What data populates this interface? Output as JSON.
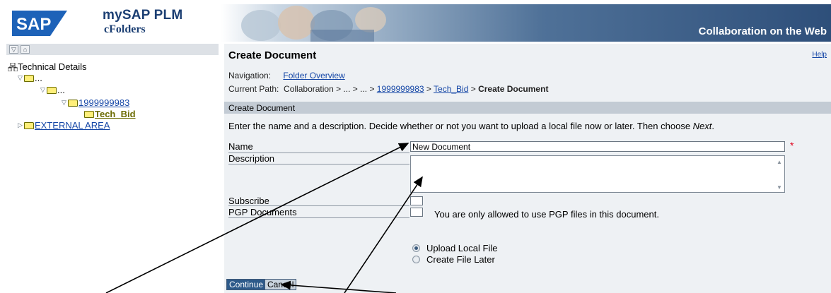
{
  "header": {
    "brand_line1": "mySAP PLM",
    "brand_line2": "cFolders",
    "logo_text": "SAP",
    "tagline": "Collaboration on the Web"
  },
  "tree": {
    "root_label": "Technical Details",
    "items": [
      {
        "label": "..."
      },
      {
        "label": "..."
      },
      {
        "label": "1999999983"
      },
      {
        "label": "Tech_Bid"
      },
      {
        "label": "EXTERNAL AREA"
      }
    ]
  },
  "page": {
    "title": "Create Document",
    "help": "Help",
    "navigation_label": "Navigation:",
    "navigation_link": "Folder Overview",
    "path_label": "Current Path:",
    "path_parts": {
      "p1": "Collaboration > ... > ... > ",
      "p2": "1999999983",
      "p3": " > ",
      "p4": "Tech_Bid",
      "p5": " > ",
      "p6": "Create Document"
    },
    "section_title": "Create Document",
    "instruction_main": "Enter the name and a description. Decide whether or not you want to upload a local file now or later. Then choose ",
    "instruction_next": "Next",
    "instruction_end": "."
  },
  "form": {
    "name_label": "Name",
    "name_value": "New Document",
    "required_mark": "*",
    "description_label": "Description",
    "subscribe_label": "Subscribe",
    "pgp_label": "PGP Documents",
    "pgp_note": "You are only allowed to use PGP files in this document.",
    "radio_upload": "Upload Local File",
    "radio_later": "Create File Later",
    "continue_label": "Continue",
    "cancel_label": "Cancel"
  }
}
